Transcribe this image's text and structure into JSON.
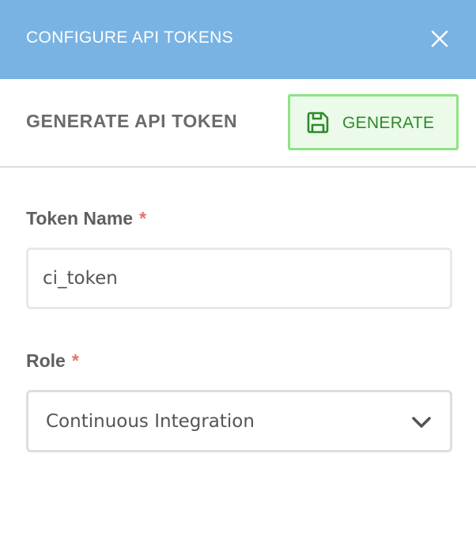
{
  "dialog": {
    "title": "CONFIGURE API TOKENS",
    "close_icon": "close-icon"
  },
  "section": {
    "title": "GENERATE API TOKEN",
    "generate_button": {
      "label": "GENERATE",
      "icon": "save-icon",
      "accent_color": "#2e8a2a",
      "border_color": "#8fe383"
    }
  },
  "form": {
    "token_name": {
      "label": "Token Name",
      "required_marker": "*",
      "value": "ci_token"
    },
    "role": {
      "label": "Role",
      "required_marker": "*",
      "selected": "Continuous Integration",
      "icon": "chevron-down-icon"
    }
  },
  "colors": {
    "header_bg": "#78b3e3",
    "required": "#e2736b"
  }
}
